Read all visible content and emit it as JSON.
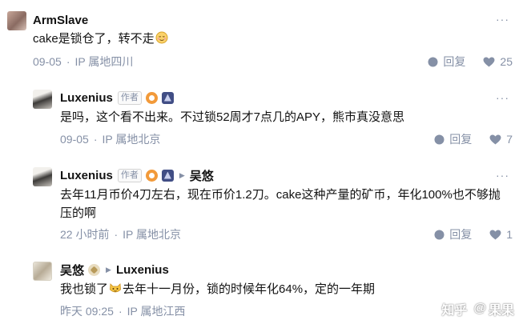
{
  "comments": [
    {
      "author": "ArmSlave",
      "text": "cake是锁仓了，转不走",
      "date": "09-05",
      "location": "IP 属地四川",
      "reply_label": "回复",
      "likes": "25"
    },
    {
      "author": "Luxenius",
      "author_tag": "作者",
      "text": "是吗，这个看不出来。不过锁52周才7点几的APY，熊市真没意思",
      "date": "09-05",
      "location": "IP 属地北京",
      "reply_label": "回复",
      "likes": "7"
    },
    {
      "author": "Luxenius",
      "author_tag": "作者",
      "reply_to": "吴悠",
      "text_line1": "去年11月币价4刀左右，现在币价1.2刀。cake这种产量的矿币，年化100%也不够抛",
      "text_line2": "压的啊",
      "date": "22 小时前",
      "location": "IP 属地北京",
      "reply_label": "回复",
      "likes": "1"
    },
    {
      "author": "吴悠",
      "reply_to": "Luxenius",
      "text_before": "我也锁了",
      "text_after": "去年十一月份，锁的时候年化64%，定的一年期",
      "date": "昨天 09:25",
      "location": "IP 属地江西"
    }
  ],
  "watermark": {
    "site": "知乎",
    "user": "果果"
  },
  "colors": {
    "meta": "#8590a6",
    "text": "#121212",
    "badge_orange": "#f29a3a",
    "badge_navy": "#414e85"
  },
  "icons": [
    "more-icon",
    "reply-bubble-icon",
    "like-heart-icon",
    "reply-arrow-icon"
  ]
}
